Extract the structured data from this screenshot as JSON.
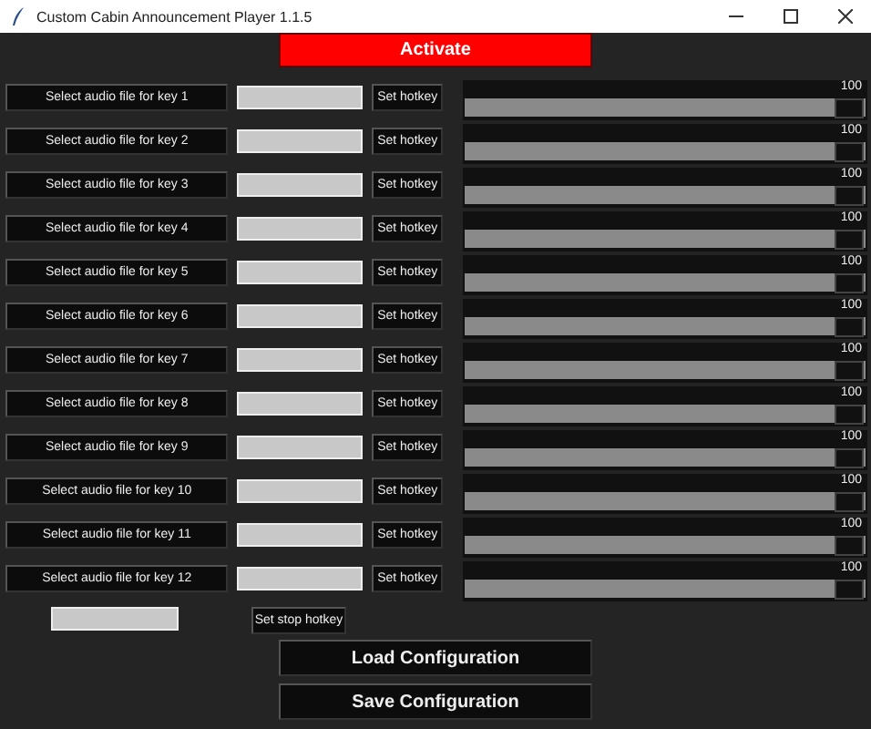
{
  "window": {
    "title": "Custom Cabin Announcement Player 1.1.5"
  },
  "activate_button": "Activate",
  "keys": [
    {
      "file_button": "Select audio file for key 1",
      "hotkey_button": "Set hotkey",
      "volume": "100",
      "level": 1
    },
    {
      "file_button": "Select audio file for key 2",
      "hotkey_button": "Set hotkey",
      "volume": "100",
      "level": 1
    },
    {
      "file_button": "Select audio file for key 3",
      "hotkey_button": "Set hotkey",
      "volume": "100",
      "level": 1
    },
    {
      "file_button": "Select audio file for key 4",
      "hotkey_button": "Set hotkey",
      "volume": "100",
      "level": 1
    },
    {
      "file_button": "Select audio file for key 5",
      "hotkey_button": "Set hotkey",
      "volume": "100",
      "level": 1
    },
    {
      "file_button": "Select audio file for key 6",
      "hotkey_button": "Set hotkey",
      "volume": "100",
      "level": 1
    },
    {
      "file_button": "Select audio file for key 7",
      "hotkey_button": "Set hotkey",
      "volume": "100",
      "level": 1
    },
    {
      "file_button": "Select audio file for key 8",
      "hotkey_button": "Set hotkey",
      "volume": "100",
      "level": 1
    },
    {
      "file_button": "Select audio file for key 9",
      "hotkey_button": "Set hotkey",
      "volume": "100",
      "level": 1
    },
    {
      "file_button": "Select audio file for key 10",
      "hotkey_button": "Set hotkey",
      "volume": "100",
      "level": 1
    },
    {
      "file_button": "Select audio file for key 11",
      "hotkey_button": "Set hotkey",
      "volume": "100",
      "level": 1
    },
    {
      "file_button": "Select audio file for key 12",
      "hotkey_button": "Set hotkey",
      "volume": "100",
      "level": 1
    }
  ],
  "stop_hotkey_button": "Set stop hotkey",
  "load_button": "Load Configuration",
  "save_button": "Save Configuration"
}
